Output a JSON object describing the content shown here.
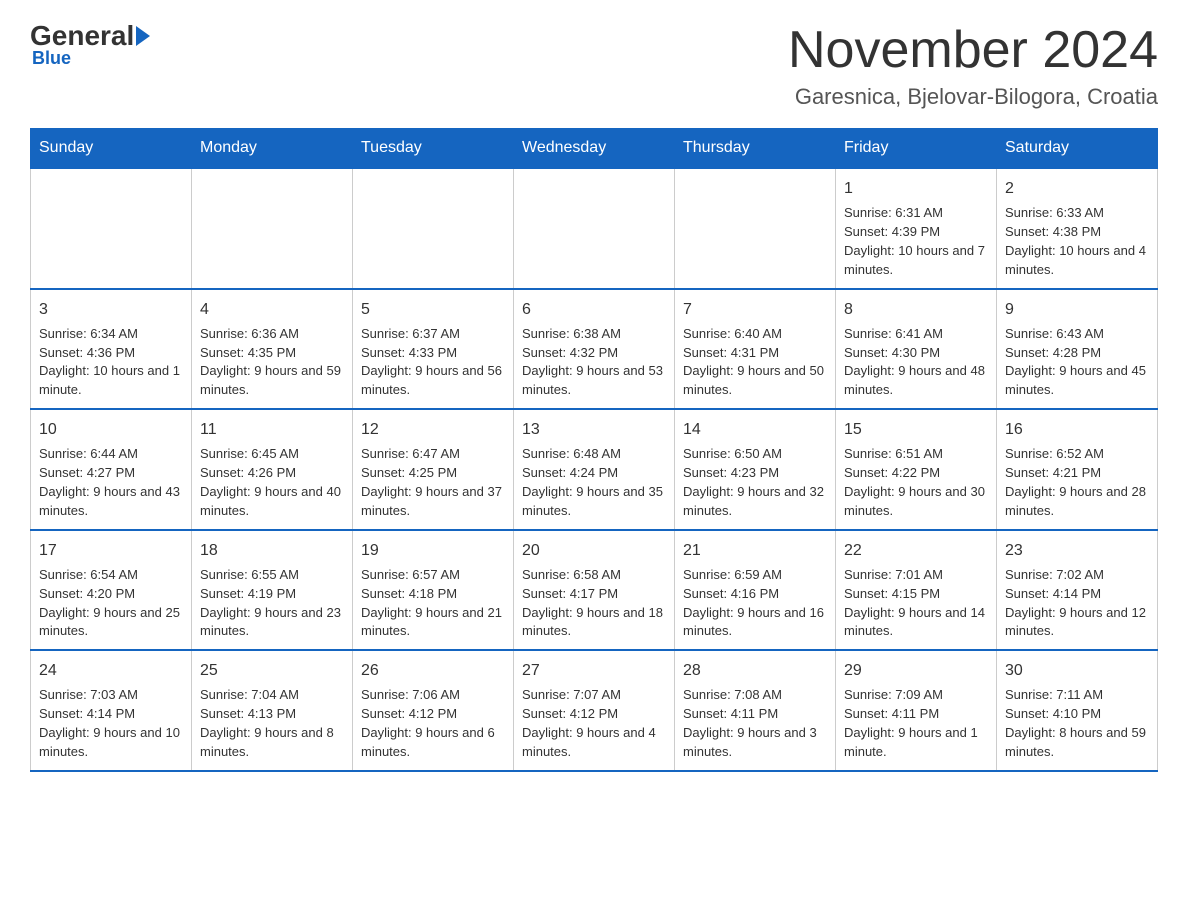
{
  "header": {
    "logo": {
      "general": "General",
      "blue": "Blue"
    },
    "title": "November 2024",
    "location": "Garesnica, Bjelovar-Bilogora, Croatia"
  },
  "days_of_week": [
    "Sunday",
    "Monday",
    "Tuesday",
    "Wednesday",
    "Thursday",
    "Friday",
    "Saturday"
  ],
  "weeks": [
    [
      {
        "day": "",
        "info": ""
      },
      {
        "day": "",
        "info": ""
      },
      {
        "day": "",
        "info": ""
      },
      {
        "day": "",
        "info": ""
      },
      {
        "day": "",
        "info": ""
      },
      {
        "day": "1",
        "info": "Sunrise: 6:31 AM\nSunset: 4:39 PM\nDaylight: 10 hours and 7 minutes."
      },
      {
        "day": "2",
        "info": "Sunrise: 6:33 AM\nSunset: 4:38 PM\nDaylight: 10 hours and 4 minutes."
      }
    ],
    [
      {
        "day": "3",
        "info": "Sunrise: 6:34 AM\nSunset: 4:36 PM\nDaylight: 10 hours and 1 minute."
      },
      {
        "day": "4",
        "info": "Sunrise: 6:36 AM\nSunset: 4:35 PM\nDaylight: 9 hours and 59 minutes."
      },
      {
        "day": "5",
        "info": "Sunrise: 6:37 AM\nSunset: 4:33 PM\nDaylight: 9 hours and 56 minutes."
      },
      {
        "day": "6",
        "info": "Sunrise: 6:38 AM\nSunset: 4:32 PM\nDaylight: 9 hours and 53 minutes."
      },
      {
        "day": "7",
        "info": "Sunrise: 6:40 AM\nSunset: 4:31 PM\nDaylight: 9 hours and 50 minutes."
      },
      {
        "day": "8",
        "info": "Sunrise: 6:41 AM\nSunset: 4:30 PM\nDaylight: 9 hours and 48 minutes."
      },
      {
        "day": "9",
        "info": "Sunrise: 6:43 AM\nSunset: 4:28 PM\nDaylight: 9 hours and 45 minutes."
      }
    ],
    [
      {
        "day": "10",
        "info": "Sunrise: 6:44 AM\nSunset: 4:27 PM\nDaylight: 9 hours and 43 minutes."
      },
      {
        "day": "11",
        "info": "Sunrise: 6:45 AM\nSunset: 4:26 PM\nDaylight: 9 hours and 40 minutes."
      },
      {
        "day": "12",
        "info": "Sunrise: 6:47 AM\nSunset: 4:25 PM\nDaylight: 9 hours and 37 minutes."
      },
      {
        "day": "13",
        "info": "Sunrise: 6:48 AM\nSunset: 4:24 PM\nDaylight: 9 hours and 35 minutes."
      },
      {
        "day": "14",
        "info": "Sunrise: 6:50 AM\nSunset: 4:23 PM\nDaylight: 9 hours and 32 minutes."
      },
      {
        "day": "15",
        "info": "Sunrise: 6:51 AM\nSunset: 4:22 PM\nDaylight: 9 hours and 30 minutes."
      },
      {
        "day": "16",
        "info": "Sunrise: 6:52 AM\nSunset: 4:21 PM\nDaylight: 9 hours and 28 minutes."
      }
    ],
    [
      {
        "day": "17",
        "info": "Sunrise: 6:54 AM\nSunset: 4:20 PM\nDaylight: 9 hours and 25 minutes."
      },
      {
        "day": "18",
        "info": "Sunrise: 6:55 AM\nSunset: 4:19 PM\nDaylight: 9 hours and 23 minutes."
      },
      {
        "day": "19",
        "info": "Sunrise: 6:57 AM\nSunset: 4:18 PM\nDaylight: 9 hours and 21 minutes."
      },
      {
        "day": "20",
        "info": "Sunrise: 6:58 AM\nSunset: 4:17 PM\nDaylight: 9 hours and 18 minutes."
      },
      {
        "day": "21",
        "info": "Sunrise: 6:59 AM\nSunset: 4:16 PM\nDaylight: 9 hours and 16 minutes."
      },
      {
        "day": "22",
        "info": "Sunrise: 7:01 AM\nSunset: 4:15 PM\nDaylight: 9 hours and 14 minutes."
      },
      {
        "day": "23",
        "info": "Sunrise: 7:02 AM\nSunset: 4:14 PM\nDaylight: 9 hours and 12 minutes."
      }
    ],
    [
      {
        "day": "24",
        "info": "Sunrise: 7:03 AM\nSunset: 4:14 PM\nDaylight: 9 hours and 10 minutes."
      },
      {
        "day": "25",
        "info": "Sunrise: 7:04 AM\nSunset: 4:13 PM\nDaylight: 9 hours and 8 minutes."
      },
      {
        "day": "26",
        "info": "Sunrise: 7:06 AM\nSunset: 4:12 PM\nDaylight: 9 hours and 6 minutes."
      },
      {
        "day": "27",
        "info": "Sunrise: 7:07 AM\nSunset: 4:12 PM\nDaylight: 9 hours and 4 minutes."
      },
      {
        "day": "28",
        "info": "Sunrise: 7:08 AM\nSunset: 4:11 PM\nDaylight: 9 hours and 3 minutes."
      },
      {
        "day": "29",
        "info": "Sunrise: 7:09 AM\nSunset: 4:11 PM\nDaylight: 9 hours and 1 minute."
      },
      {
        "day": "30",
        "info": "Sunrise: 7:11 AM\nSunset: 4:10 PM\nDaylight: 8 hours and 59 minutes."
      }
    ]
  ]
}
